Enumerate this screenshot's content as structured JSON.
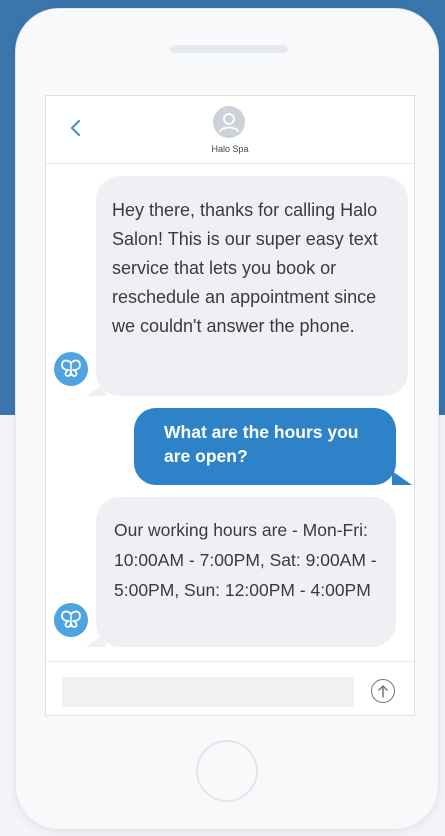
{
  "contact": {
    "name": "Halo Spa"
  },
  "messages": [
    {
      "from": "business",
      "text": "Hey there, thanks for calling Halo Salon!  This is our super easy text service that lets you book or reschedule an appointment since we couldn't answer the phone."
    },
    {
      "from": "user",
      "text": "What are the hours you are open?"
    },
    {
      "from": "business",
      "text": "Our working hours are - Mon-Fri: 10:00AM - 7:00PM, Sat: 9:00AM - 5:00PM, Sun: 12:00PM - 4:00PM"
    }
  ],
  "composer": {
    "value": "",
    "placeholder": ""
  },
  "icons": {
    "back": "chevron-left-icon",
    "avatar": "user-icon",
    "bot": "butterfly-icon",
    "send": "arrow-up-icon"
  },
  "colors": {
    "accent": "#2d82c8",
    "background_top": "#3a76ad",
    "incoming_bubble": "#eef0f3",
    "bot_badge": "#4fa3df"
  }
}
